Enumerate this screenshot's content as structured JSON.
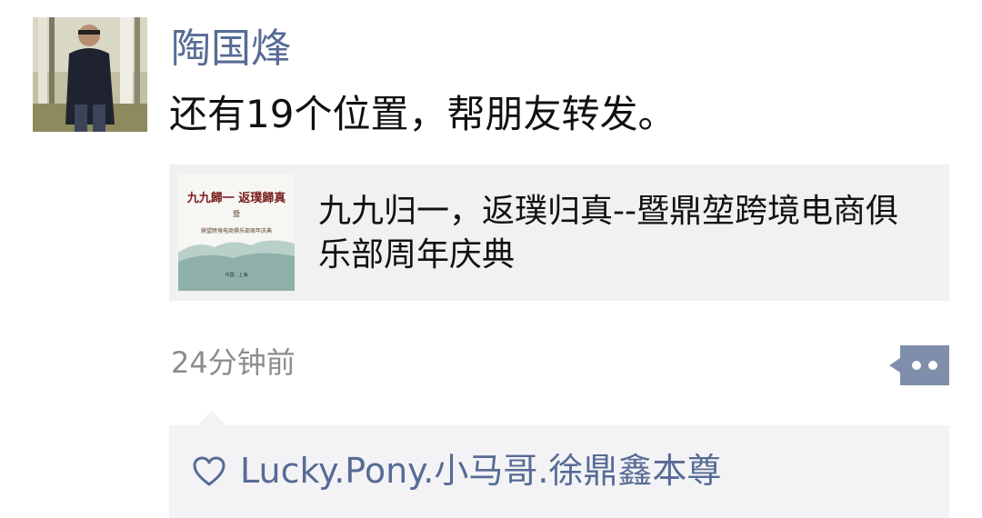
{
  "post": {
    "author": "陶国烽",
    "text": "还有19个位置，帮朋友转发。",
    "avatar_icon": "user-avatar-photo",
    "timestamp": "24分钟前"
  },
  "link_card": {
    "title": "九九归一，返璞归真--暨鼎堃跨境电商俱乐部周年庆典",
    "thumbnail": {
      "headline": "九九歸一 返璞歸真",
      "sub1": "暨",
      "sub2": "鼎望跨境电商俱乐部周年庆典",
      "location": "中国 · 上海"
    }
  },
  "actions": {
    "more_icon": "more-dots-icon"
  },
  "likes": {
    "icon": "heart-outline-icon",
    "names": "Lucky.Pony.小马哥.徐鼎鑫本尊"
  },
  "colors": {
    "link_blue": "#576b95",
    "text": "#111111",
    "muted": "#8c8c8c",
    "card_bg": "#f1f1f1",
    "likes_bg": "#f3f3f5"
  }
}
